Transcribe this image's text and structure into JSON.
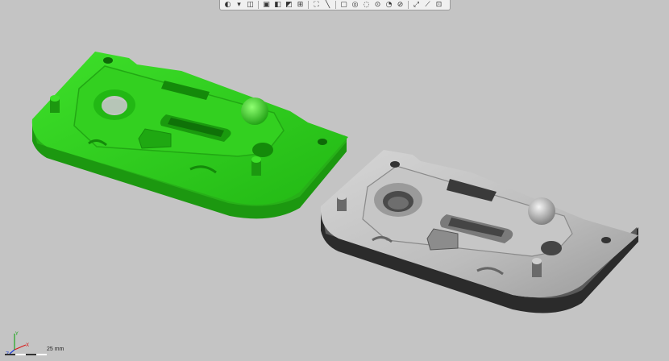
{
  "toolbar": {
    "items": [
      {
        "icon": "zoom-fit-icon",
        "glyph": "◐"
      },
      {
        "icon": "view-orientation-icon",
        "glyph": "▾"
      },
      {
        "icon": "section-view-icon",
        "glyph": "◫"
      },
      {
        "icon": "display-style-icon",
        "glyph": "▣"
      },
      {
        "icon": "hide-show-icon",
        "glyph": "◧"
      },
      {
        "icon": "edit-appearance-icon",
        "glyph": "◩"
      },
      {
        "icon": "scene-icon",
        "glyph": "⊞"
      },
      {
        "icon": "view-settings-icon",
        "glyph": "⛶"
      },
      {
        "icon": "sketch-line-icon",
        "glyph": "╲"
      },
      {
        "icon": "rectangle-icon",
        "glyph": "▢"
      },
      {
        "icon": "circle-icon",
        "glyph": "◎"
      },
      {
        "icon": "arc-icon",
        "glyph": "◌"
      },
      {
        "icon": "point-icon",
        "glyph": "⊙"
      },
      {
        "icon": "dimension-icon",
        "glyph": "◔"
      },
      {
        "icon": "relations-icon",
        "glyph": "⊘"
      },
      {
        "icon": "smart-dim-icon",
        "glyph": "⤢"
      },
      {
        "icon": "trim-icon",
        "glyph": "⟋"
      },
      {
        "icon": "mirror-icon",
        "glyph": "⊡"
      }
    ]
  },
  "scale": {
    "label": "25 mm"
  },
  "triad": {
    "y_label": "Y",
    "x_label": "X",
    "z_label": "Z"
  },
  "colors": {
    "background": "#c4c4c4",
    "green_part": "#2fcc1f",
    "gray_part": "#b4b4b4",
    "triad_x": "#d81b1b",
    "triad_y": "#1fa61f",
    "triad_z": "#1f3fd8"
  }
}
